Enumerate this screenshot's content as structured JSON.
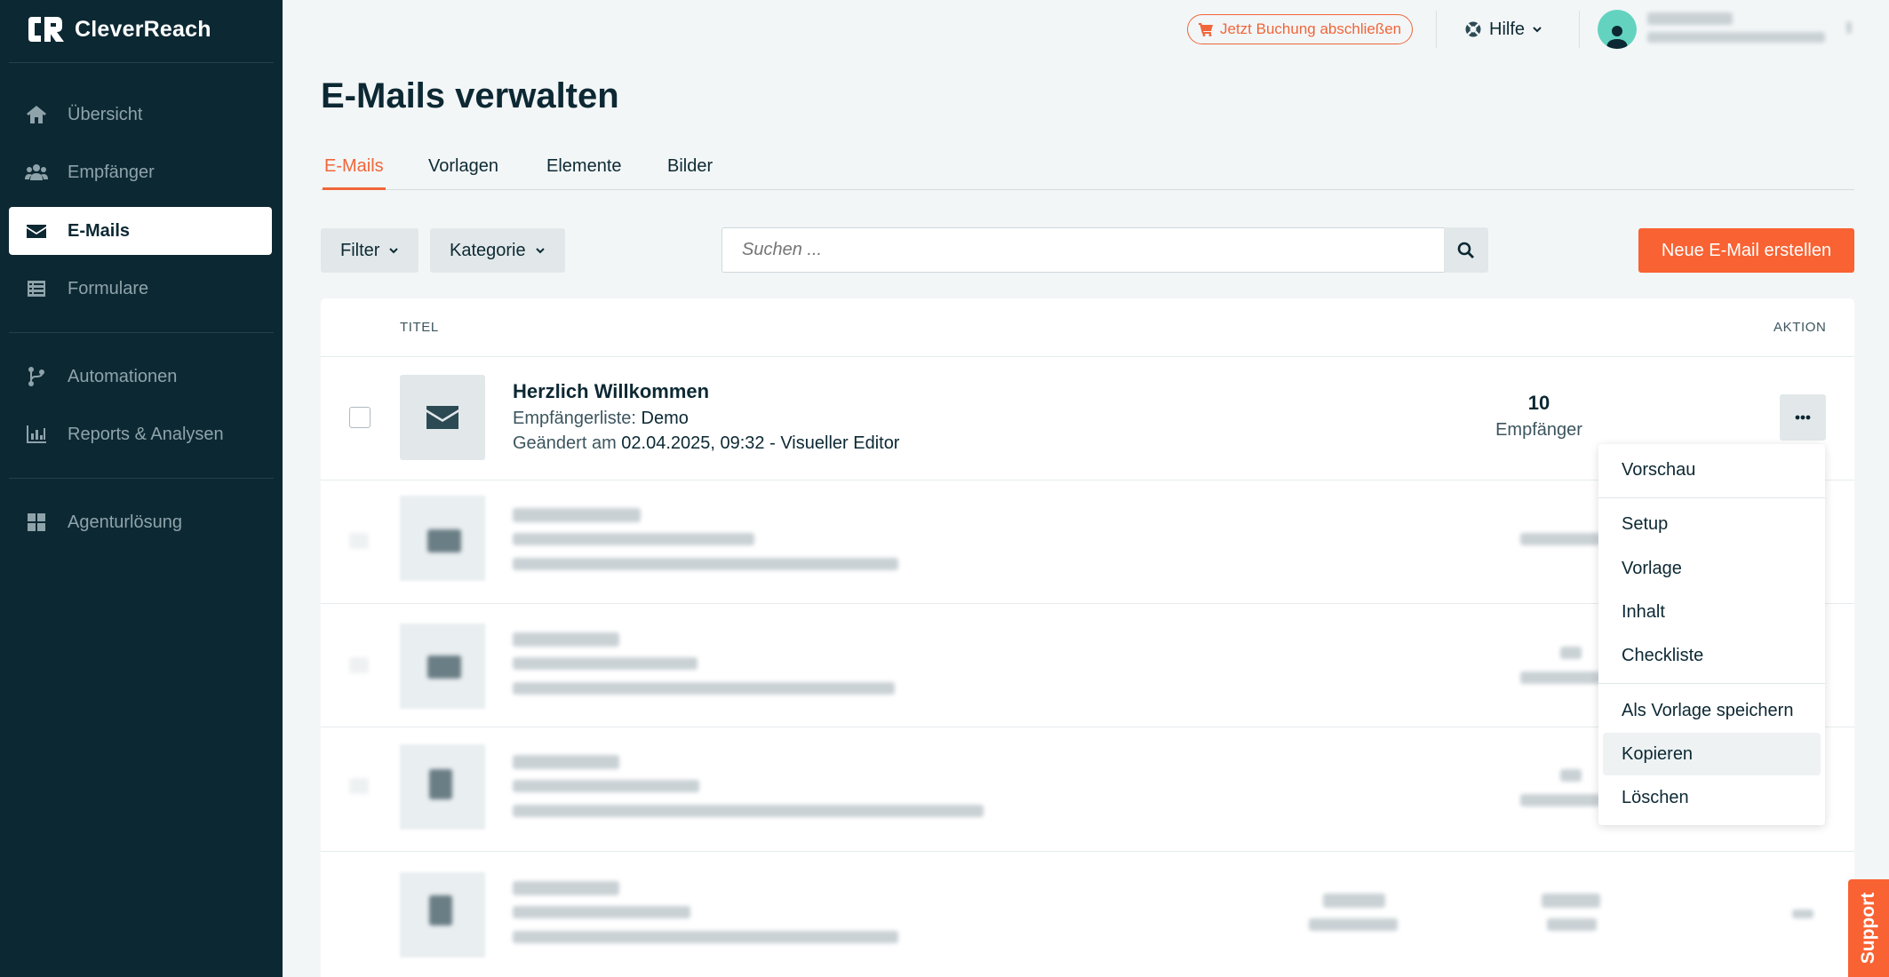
{
  "app": {
    "name": "CleverReach"
  },
  "colors": {
    "accent": "#f96233",
    "sidebar": "#0c2833",
    "avatar": "#63d3c0"
  },
  "sidebar": {
    "items": [
      {
        "label": "Übersicht",
        "icon": "home-icon"
      },
      {
        "label": "Empfänger",
        "icon": "users-icon"
      },
      {
        "label": "E-Mails",
        "icon": "envelope-icon",
        "active": true
      },
      {
        "label": "Formulare",
        "icon": "form-icon"
      },
      {
        "label": "Automationen",
        "icon": "branch-icon"
      },
      {
        "label": "Reports & Analysen",
        "icon": "chart-icon"
      },
      {
        "label": "Agenturlösung",
        "icon": "grid-icon"
      }
    ]
  },
  "topbar": {
    "booking_label": "Jetzt Buchung abschließen",
    "help_label": "Hilfe"
  },
  "page": {
    "title": "E-Mails verwalten"
  },
  "tabs": [
    {
      "label": "E-Mails",
      "active": true
    },
    {
      "label": "Vorlagen"
    },
    {
      "label": "Elemente"
    },
    {
      "label": "Bilder"
    }
  ],
  "toolbar": {
    "filter_label": "Filter",
    "category_label": "Kategorie",
    "search_placeholder": "Suchen ...",
    "new_mail_label": "Neue E-Mail erstellen"
  },
  "table": {
    "headers": {
      "title": "TITEL",
      "action": "AKTION"
    },
    "first_row": {
      "title": "Herzlich Willkommen",
      "list_label": "Empfängerliste:",
      "list_value": "Demo",
      "changed_label": "Geändert am",
      "changed_value": "02.04.2025, 09:32 - Visueller Editor",
      "recipients_count": "10",
      "recipients_label": "Empfänger"
    }
  },
  "action_menu": {
    "items": [
      "Vorschau",
      "Setup",
      "Vorlage",
      "Inhalt",
      "Checkliste",
      "Als Vorlage speichern",
      "Kopieren",
      "Löschen"
    ],
    "highlighted": "Kopieren"
  },
  "support_label": "Support"
}
